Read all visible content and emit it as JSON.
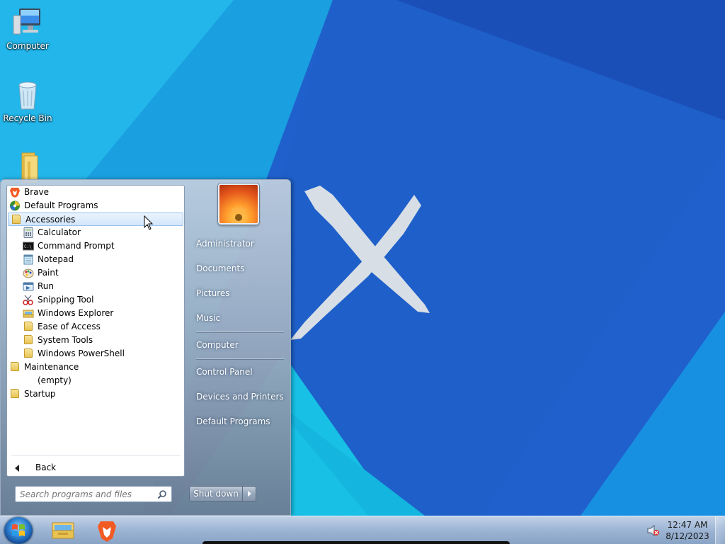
{
  "desktop": {
    "icons": [
      {
        "label": "Computer",
        "icon": "computer-icon"
      },
      {
        "label": "Recycle Bin",
        "icon": "recycle-bin-icon"
      },
      {
        "label": "",
        "icon": "folder-icon"
      }
    ]
  },
  "start_menu": {
    "programs": [
      {
        "label": "Brave",
        "icon": "brave-icon",
        "level": 0
      },
      {
        "label": "Default Programs",
        "icon": "default-programs-icon",
        "level": 0
      },
      {
        "label": "Accessories",
        "icon": "folder-icon",
        "level": 0,
        "selected": true
      },
      {
        "label": "Calculator",
        "icon": "calculator-icon",
        "level": 1
      },
      {
        "label": "Command Prompt",
        "icon": "command-prompt-icon",
        "level": 1
      },
      {
        "label": "Notepad",
        "icon": "notepad-icon",
        "level": 1
      },
      {
        "label": "Paint",
        "icon": "paint-icon",
        "level": 1
      },
      {
        "label": "Run",
        "icon": "run-icon",
        "level": 1
      },
      {
        "label": "Snipping Tool",
        "icon": "snipping-tool-icon",
        "level": 1
      },
      {
        "label": "Windows Explorer",
        "icon": "explorer-icon",
        "level": 1
      },
      {
        "label": "Ease of Access",
        "icon": "folder-icon",
        "level": 1
      },
      {
        "label": "System Tools",
        "icon": "folder-icon",
        "level": 1
      },
      {
        "label": "Windows PowerShell",
        "icon": "folder-icon",
        "level": 1
      },
      {
        "label": "Maintenance",
        "icon": "folder-icon",
        "level": 0
      },
      {
        "label": "(empty)",
        "icon": "",
        "level": 1
      },
      {
        "label": "Startup",
        "icon": "folder-icon",
        "level": 0
      }
    ],
    "back_label": "Back",
    "search_placeholder": "Search programs and files",
    "right_items": [
      {
        "label": "Administrator"
      },
      {
        "label": "Documents"
      },
      {
        "label": "Pictures"
      },
      {
        "label": "Music"
      },
      {
        "label": "Computer"
      },
      {
        "label": "Control Panel"
      },
      {
        "label": "Devices and Printers"
      },
      {
        "label": "Default Programs"
      }
    ],
    "shutdown_label": "Shut down"
  },
  "taskbar": {
    "pinned": [
      {
        "name": "windows-explorer",
        "icon": "folder-library-icon"
      },
      {
        "name": "brave",
        "icon": "brave-icon"
      }
    ],
    "clock": {
      "time": "12:47 AM",
      "date": "8/12/2023"
    },
    "volume_icon": "speaker-muted-icon"
  },
  "colors": {
    "wallpaper_dark": "#1b5fc7",
    "wallpaper_light": "#1fb8e8",
    "selection": "#d3e6fb"
  }
}
